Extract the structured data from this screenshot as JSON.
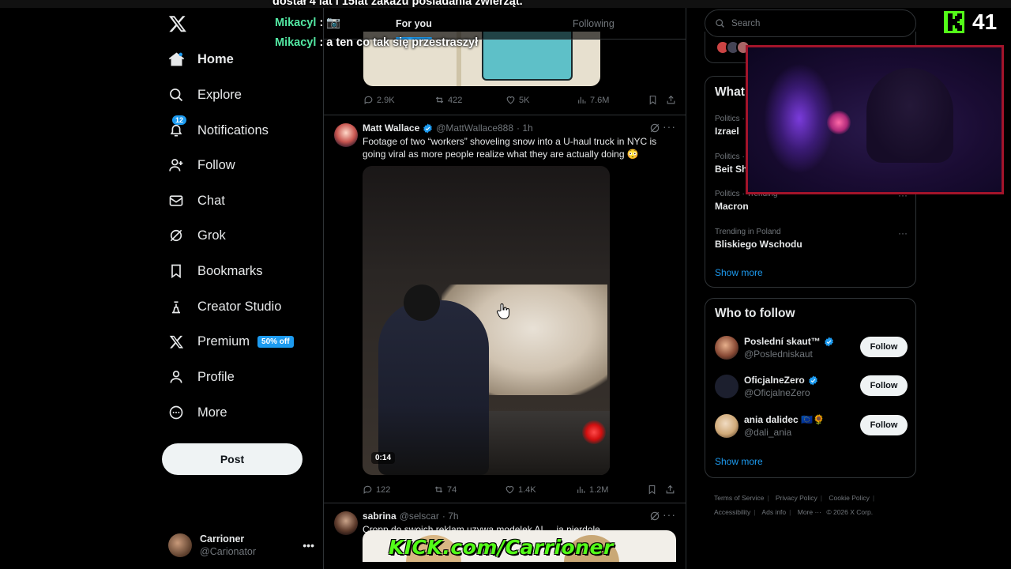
{
  "sidebar": {
    "items": [
      {
        "label": "Home",
        "icon": "home-icon",
        "active": true
      },
      {
        "label": "Explore",
        "icon": "search-icon"
      },
      {
        "label": "Notifications",
        "icon": "bell-icon",
        "badge": "12"
      },
      {
        "label": "Follow",
        "icon": "add-person-icon"
      },
      {
        "label": "Chat",
        "icon": "envelope-icon"
      },
      {
        "label": "Grok",
        "icon": "grok-icon"
      },
      {
        "label": "Bookmarks",
        "icon": "bookmark-icon"
      },
      {
        "label": "Creator Studio",
        "icon": "creator-studio-icon"
      },
      {
        "label": "Premium",
        "icon": "x-logo-icon",
        "promo": "50% off"
      },
      {
        "label": "Profile",
        "icon": "person-icon"
      },
      {
        "label": "More",
        "icon": "more-circle-icon"
      }
    ],
    "post_label": "Post",
    "account": {
      "name": "Carrioner",
      "handle": "@Carionator"
    }
  },
  "tabs": {
    "for_you": "For you",
    "following": "Following"
  },
  "prev_tweet": {
    "replies": "2.9K",
    "reposts": "422",
    "likes": "5K",
    "views": "7.6M"
  },
  "tweets": [
    {
      "name": "Matt Wallace",
      "handle": "@MattWallace888",
      "time": "· 1h",
      "text": "Footage of two “workers” shoveling snow into a U-haul truck in NYC is going viral as more people realize what they are actually doing 😳",
      "video_time": "0:14",
      "replies": "122",
      "reposts": "74",
      "likes": "1.4K",
      "views": "1.2M"
    },
    {
      "name": "sabrina",
      "handle": "@selscar",
      "time": "· 7h",
      "text": "Cropp do swoich reklam uzywa modelek AI ... ja pierdole"
    }
  ],
  "right": {
    "search_placeholder": "Search",
    "trends_title": "What",
    "trends": [
      {
        "category": "Politics ·",
        "title": "Izrael"
      },
      {
        "category": "Politics ·",
        "title": "Beit Sh"
      },
      {
        "category": "Politics · Trending",
        "title": "Macron"
      },
      {
        "category": "Trending in Poland",
        "title": "Bliskiego Wschodu"
      }
    ],
    "show_more": "Show more",
    "who_title": "Who to follow",
    "who": [
      {
        "name": "Poslední skaut™",
        "handle": "@Posledniskaut",
        "verified": true,
        "button": "Follow"
      },
      {
        "name": "OficjalneZero",
        "handle": "@OficjalneZero",
        "verified": true,
        "button": "Follow"
      },
      {
        "name": "ania dalidec 🇪🇺🌻",
        "handle": "@dali_ania",
        "verified": false,
        "button": "Follow"
      }
    ],
    "footer": [
      "Terms of Service",
      "Privacy Policy",
      "Cookie Policy",
      "Accessibility",
      "Ads info",
      "More ···",
      "© 2026 X Corp."
    ]
  },
  "stream": {
    "chat": [
      {
        "user": "",
        "msg": "dostał 4 lat i 15lat zakazu posiadania zwierząt."
      },
      {
        "user": "Mikacyl",
        "msg": ": 📷"
      },
      {
        "user": "Mikacyl",
        "msg": ": a ten co tak się przestraszył"
      }
    ],
    "viewer_count": "41",
    "url": "KICK.com/Carrioner",
    "brand_color": "#53fc18"
  },
  "colors": {
    "accent": "#1d9bf0",
    "background": "#000000",
    "border": "#2f3336",
    "muted": "#71767b"
  }
}
